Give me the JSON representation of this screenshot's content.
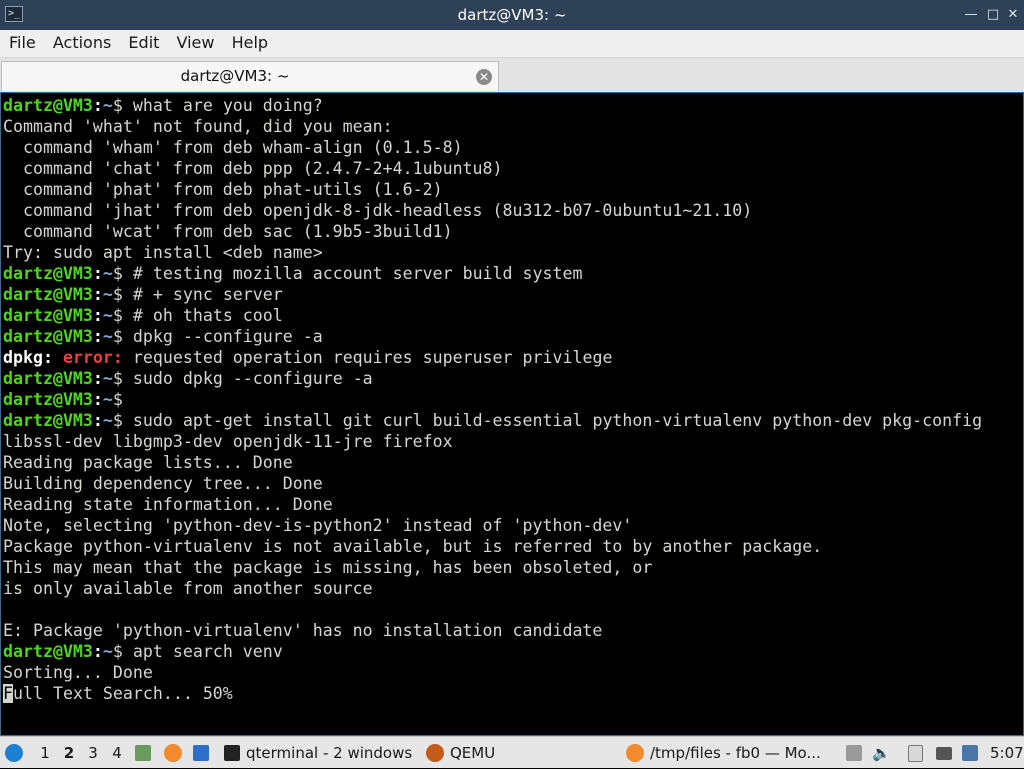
{
  "window": {
    "title": "dartz@VM3: ~"
  },
  "menu": {
    "items": [
      "File",
      "Actions",
      "Edit",
      "View",
      "Help"
    ]
  },
  "tabs": [
    {
      "label": "dartz@VM3: ~"
    }
  ],
  "terminal": {
    "lines": [
      {
        "type": "prompt",
        "user": "dartz@VM3",
        "path": "~",
        "cmd": "what are you doing?"
      },
      {
        "type": "out",
        "text": "Command 'what' not found, did you mean:"
      },
      {
        "type": "out",
        "text": "  command 'wham' from deb wham-align (0.1.5-8)"
      },
      {
        "type": "out",
        "text": "  command 'chat' from deb ppp (2.4.7-2+4.1ubuntu8)"
      },
      {
        "type": "out",
        "text": "  command 'phat' from deb phat-utils (1.6-2)"
      },
      {
        "type": "out",
        "text": "  command 'jhat' from deb openjdk-8-jdk-headless (8u312-b07-0ubuntu1~21.10)"
      },
      {
        "type": "out",
        "text": "  command 'wcat' from deb sac (1.9b5-3build1)"
      },
      {
        "type": "out",
        "text": "Try: sudo apt install <deb name>"
      },
      {
        "type": "prompt",
        "user": "dartz@VM3",
        "path": "~",
        "cmd": "# testing mozilla account server build system"
      },
      {
        "type": "prompt",
        "user": "dartz@VM3",
        "path": "~",
        "cmd": "# + sync server"
      },
      {
        "type": "prompt",
        "user": "dartz@VM3",
        "path": "~",
        "cmd": "# oh thats cool"
      },
      {
        "type": "prompt",
        "user": "dartz@VM3",
        "path": "~",
        "cmd": "dpkg --configure -a"
      },
      {
        "type": "error",
        "prog": "dpkg:",
        "label": "error:",
        "text": "requested operation requires superuser privilege"
      },
      {
        "type": "prompt",
        "user": "dartz@VM3",
        "path": "~",
        "cmd": "sudo dpkg --configure -a"
      },
      {
        "type": "prompt",
        "user": "dartz@VM3",
        "path": "~",
        "cmd": ""
      },
      {
        "type": "prompt",
        "user": "dartz@VM3",
        "path": "~",
        "cmd": "sudo apt-get install git curl build-essential python-virtualenv python-dev pkg-config"
      },
      {
        "type": "out",
        "text": "libssl-dev libgmp3-dev openjdk-11-jre firefox"
      },
      {
        "type": "out",
        "text": "Reading package lists... Done"
      },
      {
        "type": "out",
        "text": "Building dependency tree... Done"
      },
      {
        "type": "out",
        "text": "Reading state information... Done"
      },
      {
        "type": "out",
        "text": "Note, selecting 'python-dev-is-python2' instead of 'python-dev'"
      },
      {
        "type": "out",
        "text": "Package python-virtualenv is not available, but is referred to by another package."
      },
      {
        "type": "out",
        "text": "This may mean that the package is missing, has been obsoleted, or"
      },
      {
        "type": "out",
        "text": "is only available from another source"
      },
      {
        "type": "out",
        "text": ""
      },
      {
        "type": "out",
        "text": "E: Package 'python-virtualenv' has no installation candidate"
      },
      {
        "type": "prompt",
        "user": "dartz@VM3",
        "path": "~",
        "cmd": "apt search venv"
      },
      {
        "type": "out",
        "text": "Sorting... Done"
      },
      {
        "type": "cursor",
        "first": "F",
        "rest": "ull Text Search... 50%"
      }
    ]
  },
  "taskbar": {
    "workspaces": [
      "1",
      "2",
      "3",
      "4"
    ],
    "active_workspace": "2",
    "tasks": [
      {
        "label": "qterminal - 2 windows",
        "icon": "terminal-icon"
      },
      {
        "label": "QEMU",
        "icon": "qemu-icon"
      },
      {
        "label": "/tmp/files - fb0 — Mo...",
        "icon": "firefox-icon"
      }
    ],
    "clock": "5:07",
    "colors": {
      "accent": "#2e4156",
      "prompt_user": "#4fd61c",
      "prompt_path": "#7ea7d8",
      "error": "#ef3e3e"
    }
  }
}
